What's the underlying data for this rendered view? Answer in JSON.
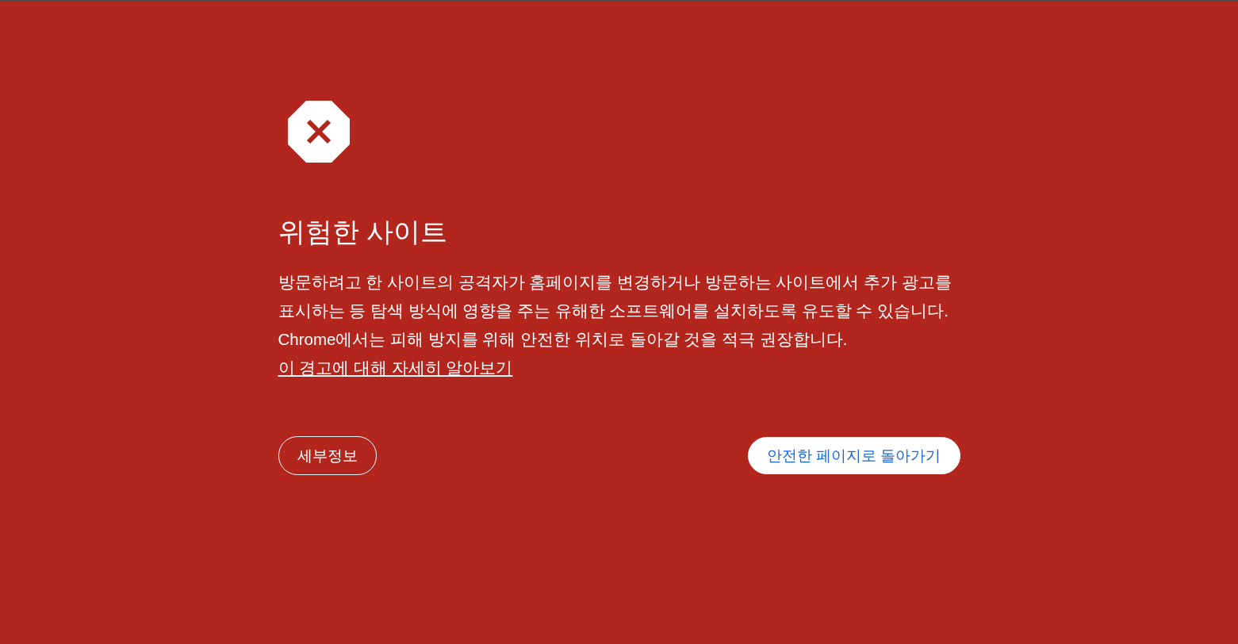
{
  "heading": "위험한 사이트",
  "message": {
    "text": "방문하려고 한 사이트의 공격자가 홈페이지를 변경하거나 방문하는 사이트에서 추가 광고를 표시하는 등 탐색 방식에 영향을 주는 유해한 소프트웨어를 설치하도록 유도할 수 있습니다. Chrome에서는 피해 방지를 위해 안전한 위치로 돌아갈 것을 적극 권장합니다.",
    "link": "이 경고에 대해 자세히 알아보기"
  },
  "buttons": [
    {
      "label": "세부정보",
      "kind": "secondary"
    },
    {
      "label": "안전한 페이지로 돌아가기",
      "kind": "primary"
    }
  ]
}
